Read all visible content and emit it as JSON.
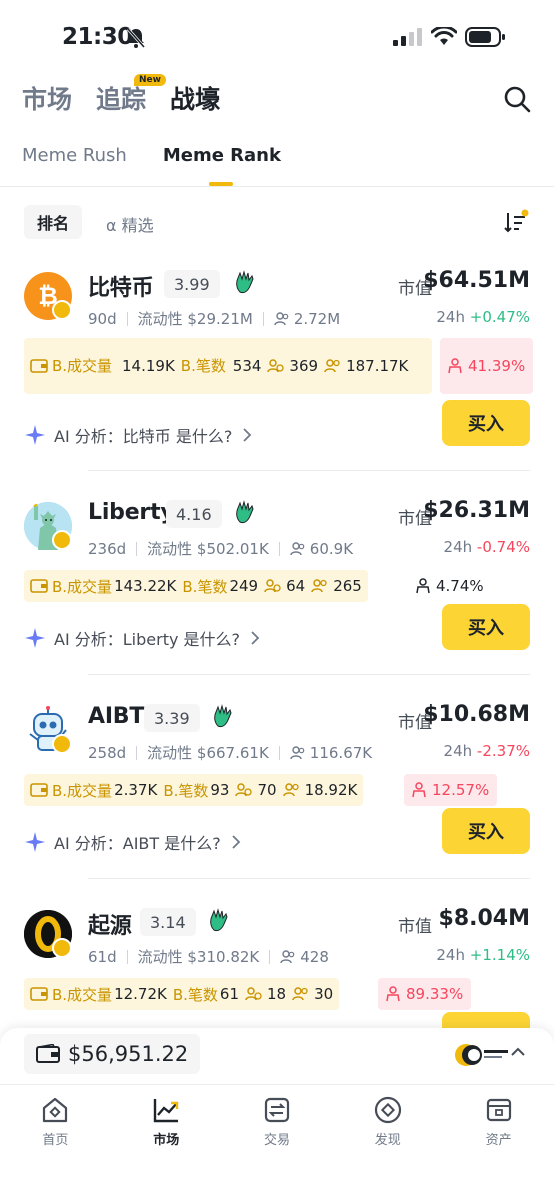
{
  "status_bar": {
    "time": "21:30"
  },
  "top_tabs": [
    {
      "label": "市场",
      "active": false
    },
    {
      "label": "追踪",
      "active": false,
      "badge": "New"
    },
    {
      "label": "战壕",
      "active": true
    }
  ],
  "sub_tabs": [
    {
      "label": "Meme Rush",
      "active": false
    },
    {
      "label": "Meme Rank",
      "active": true
    }
  ],
  "filters": {
    "rank_label": "排名",
    "select_label": "α 精选"
  },
  "tokens": [
    {
      "name": "比特币",
      "score": "3.99",
      "age": "90d",
      "liquidity": "流动性 $29.21M",
      "holders": "2.72M",
      "mcap_label": "市值",
      "mcap": "$64.51M",
      "chg_label": "24h",
      "chg": "+0.47%",
      "chg_dir": "up",
      "vol_label": "B.成交量",
      "vol": "14.19K",
      "tx_label": "B.笔数",
      "tx": "534",
      "smart": "369",
      "kol": "187.17K",
      "top10": "41.39%",
      "top10_style": "red",
      "ai": "AI 分析：比特币 是什么?",
      "buy": "买入",
      "logo_color": "#f7931a"
    },
    {
      "name": "Liberty",
      "score": "4.16",
      "age": "236d",
      "liquidity": "流动性 $502.01K",
      "holders": "60.9K",
      "mcap_label": "市值",
      "mcap": "$26.31M",
      "chg_label": "24h",
      "chg": "-0.74%",
      "chg_dir": "down",
      "vol_label": "B.成交量",
      "vol": "143.22K",
      "tx_label": "B.笔数",
      "tx": "249",
      "smart": "64",
      "kol": "265",
      "top10": "4.74%",
      "top10_style": "plain",
      "ai": "AI 分析：Liberty 是什么?",
      "buy": "买入",
      "logo_color": "#9ed8ef"
    },
    {
      "name": "AIBT",
      "score": "3.39",
      "age": "258d",
      "liquidity": "流动性 $667.61K",
      "holders": "116.67K",
      "mcap_label": "市值",
      "mcap": "$10.68M",
      "chg_label": "24h",
      "chg": "-2.37%",
      "chg_dir": "down",
      "vol_label": "B.成交量",
      "vol": "2.37K",
      "tx_label": "B.笔数",
      "tx": "93",
      "smart": "70",
      "kol": "18.92K",
      "top10": "12.57%",
      "top10_style": "red",
      "ai": "AI 分析：AIBT 是什么?",
      "buy": "买入",
      "logo_color": "#ffffff"
    },
    {
      "name": "起源",
      "score": "3.14",
      "age": "61d",
      "liquidity": "流动性 $310.82K",
      "holders": "428",
      "mcap_label": "市值",
      "mcap": "$8.04M",
      "chg_label": "24h",
      "chg": "+1.14%",
      "chg_dir": "up",
      "vol_label": "B.成交量",
      "vol": "12.72K",
      "tx_label": "B.笔数",
      "tx": "61",
      "smart": "18",
      "kol": "30",
      "top10": "89.33%",
      "top10_style": "red",
      "ai": "",
      "buy": "",
      "logo_color": "#111111"
    }
  ],
  "wallet": {
    "balance": "$56,951.22"
  },
  "bottom_nav": [
    {
      "label": "首页",
      "icon": "home-icon",
      "active": false
    },
    {
      "label": "市场",
      "icon": "chart-icon",
      "active": true
    },
    {
      "label": "交易",
      "icon": "trade-icon",
      "active": false
    },
    {
      "label": "发现",
      "icon": "discover-icon",
      "active": false
    },
    {
      "label": "资产",
      "icon": "wallet-icon",
      "active": false
    }
  ],
  "colors": {
    "accent": "#f0b90b",
    "buy": "#fcd535",
    "up": "#2ebd85",
    "down": "#f6465d"
  }
}
